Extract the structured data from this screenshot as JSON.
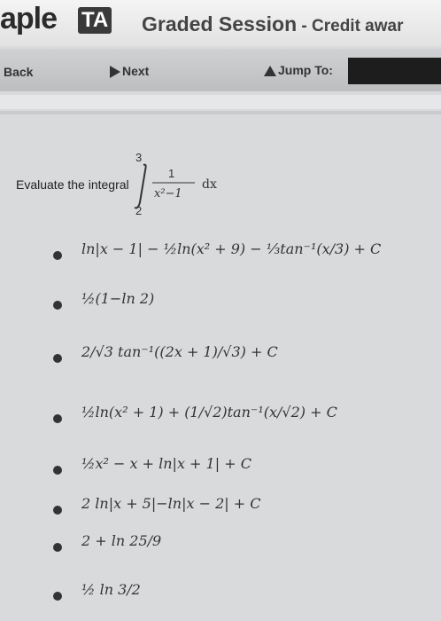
{
  "header": {
    "logo_text": "aple",
    "logo_badge": "TA",
    "session_title": "Graded Session",
    "session_sub": " - Credit awar"
  },
  "nav": {
    "back": "Back",
    "next": "Next",
    "jump": "Jump To:"
  },
  "question": {
    "prompt": "Evaluate the integral",
    "upper": "3",
    "lower": "2",
    "num": "1",
    "den": "x²−1",
    "dx": "dx"
  },
  "options": [
    {
      "id": "a",
      "text": "ln|x − 1| − ½ln(x² + 9) − ⅓tan⁻¹(x/3) + C"
    },
    {
      "id": "b",
      "text": "½(1−ln 2)"
    },
    {
      "id": "c",
      "text": "2/√3 tan⁻¹((2x + 1)/√3) + C"
    },
    {
      "id": "d",
      "text": "½ln(x² + 1) + (1/√2)tan⁻¹(x/√2) + C"
    },
    {
      "id": "e",
      "text": "½x² − x + ln|x + 1| + C"
    },
    {
      "id": "f",
      "text": "2 ln|x + 5|−ln|x − 2| + C"
    },
    {
      "id": "g",
      "text": "2 + ln 25/9"
    },
    {
      "id": "h",
      "text": "½ ln 3/2"
    }
  ]
}
